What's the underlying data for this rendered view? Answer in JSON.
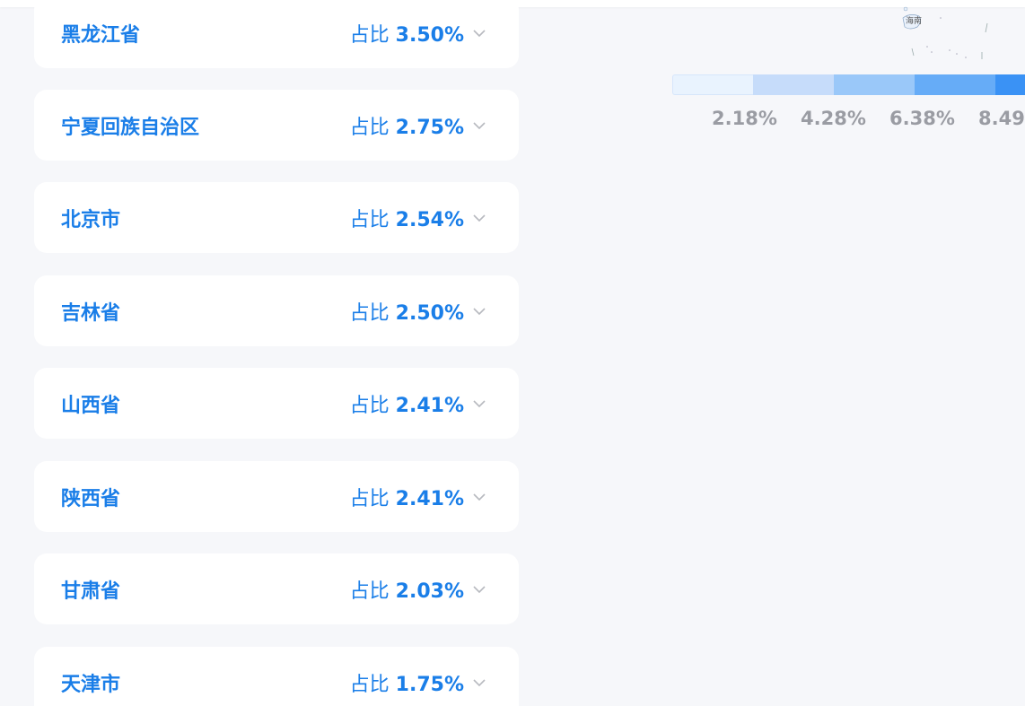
{
  "share_prefix": "占比",
  "provinces": [
    {
      "name": "黑龙江省",
      "share": "3.50%"
    },
    {
      "name": "宁夏回族自治区",
      "share": "2.75%"
    },
    {
      "name": "北京市",
      "share": "2.54%"
    },
    {
      "name": "吉林省",
      "share": "2.50%"
    },
    {
      "name": "山西省",
      "share": "2.41%"
    },
    {
      "name": "陕西省",
      "share": "2.41%"
    },
    {
      "name": "甘肃省",
      "share": "2.03%"
    },
    {
      "name": "天津市",
      "share": "1.75%"
    }
  ],
  "map": {
    "visible_label": "海南"
  },
  "legend": {
    "labels": [
      "2.18%",
      "4.28%",
      "6.38%",
      "8.49%"
    ],
    "colors": [
      "#e9f3fe",
      "#c6dcfa",
      "#9ac8f9",
      "#66acf7",
      "#3a92f5"
    ]
  },
  "colors": {
    "accent": "#1a7ee8",
    "label_gray": "#9a9ca3",
    "background": "#f6f7fa"
  }
}
